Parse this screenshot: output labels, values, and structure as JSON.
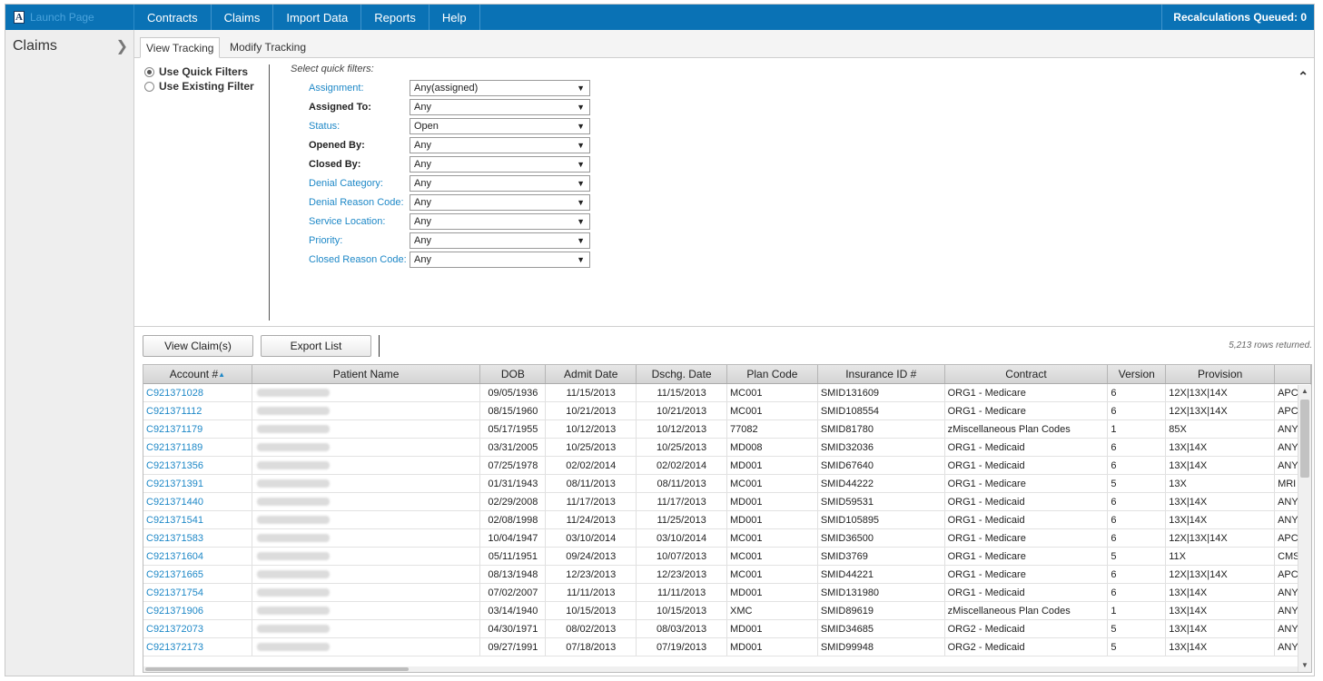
{
  "topbar": {
    "launch_label": "Launch Page",
    "logo_letter": "A",
    "nav": [
      "Contracts",
      "Claims",
      "Import Data",
      "Reports",
      "Help"
    ],
    "recalc": "Recalculations Queued: 0"
  },
  "sidebar": {
    "title": "Claims"
  },
  "tabs": [
    "View Tracking",
    "Modify Tracking"
  ],
  "filter_mode": {
    "quick": "Use Quick Filters",
    "existing": "Use Existing Filter",
    "selected": "quick"
  },
  "quick_filters": {
    "title": "Select quick filters:",
    "rows": [
      {
        "label": "Assignment:",
        "value": "Any(assigned)",
        "style": "link"
      },
      {
        "label": "Assigned To:",
        "value": "Any",
        "style": "bold"
      },
      {
        "label": "Status:",
        "value": "Open",
        "style": "link"
      },
      {
        "label": "Opened By:",
        "value": "Any",
        "style": "bold"
      },
      {
        "label": "Closed By:",
        "value": "Any",
        "style": "bold"
      },
      {
        "label": "Denial Category:",
        "value": "Any",
        "style": "link"
      },
      {
        "label": "Denial Reason Code:",
        "value": "Any",
        "style": "link"
      },
      {
        "label": "Service Location:",
        "value": "Any",
        "style": "link"
      },
      {
        "label": "Priority:",
        "value": "Any",
        "style": "link"
      },
      {
        "label": "Closed Reason Code:",
        "value": "Any",
        "style": "link"
      }
    ]
  },
  "actions": {
    "view": "View Claim(s)",
    "export": "Export List",
    "rows_returned": "5,213 rows returned."
  },
  "table": {
    "sort_column": "Account #",
    "sort_dir": "asc",
    "columns": [
      "Account #",
      "Patient Name",
      "DOB",
      "Admit Date",
      "Dschg. Date",
      "Plan Code",
      "Insurance ID #",
      "Contract",
      "Version",
      "Provision",
      ""
    ],
    "rows": [
      [
        "C921371028",
        "",
        "09/05/1936",
        "11/15/2013",
        "11/15/2013",
        "MC001",
        "SMID131609",
        "ORG1 - Medicare",
        "6",
        "12X|13X|14X",
        "APC"
      ],
      [
        "C921371112",
        "",
        "08/15/1960",
        "10/21/2013",
        "10/21/2013",
        "MC001",
        "SMID108554",
        "ORG1 - Medicare",
        "6",
        "12X|13X|14X",
        "APC"
      ],
      [
        "C921371179",
        "",
        "05/17/1955",
        "10/12/2013",
        "10/12/2013",
        "77082",
        "SMID81780",
        "zMiscellaneous Plan Codes",
        "1",
        "85X",
        "ANY"
      ],
      [
        "C921371189",
        "",
        "03/31/2005",
        "10/25/2013",
        "10/25/2013",
        "MD008",
        "SMID32036",
        "ORG1 - Medicaid",
        "6",
        "13X|14X",
        "ANY"
      ],
      [
        "C921371356",
        "",
        "07/25/1978",
        "02/02/2014",
        "02/02/2014",
        "MD001",
        "SMID67640",
        "ORG1 - Medicaid",
        "6",
        "13X|14X",
        "ANY"
      ],
      [
        "C921371391",
        "",
        "01/31/1943",
        "08/11/2013",
        "08/11/2013",
        "MC001",
        "SMID44222",
        "ORG1 - Medicare",
        "5",
        "13X",
        "MRI"
      ],
      [
        "C921371440",
        "",
        "02/29/2008",
        "11/17/2013",
        "11/17/2013",
        "MD001",
        "SMID59531",
        "ORG1 - Medicaid",
        "6",
        "13X|14X",
        "ANY"
      ],
      [
        "C921371541",
        "",
        "02/08/1998",
        "11/24/2013",
        "11/25/2013",
        "MD001",
        "SMID105895",
        "ORG1 - Medicaid",
        "6",
        "13X|14X",
        "ANY"
      ],
      [
        "C921371583",
        "",
        "10/04/1947",
        "03/10/2014",
        "03/10/2014",
        "MC001",
        "SMID36500",
        "ORG1 - Medicare",
        "6",
        "12X|13X|14X",
        "APC"
      ],
      [
        "C921371604",
        "",
        "05/11/1951",
        "09/24/2013",
        "10/07/2013",
        "MC001",
        "SMID3769",
        "ORG1 - Medicare",
        "5",
        "11X",
        "CMS"
      ],
      [
        "C921371665",
        "",
        "08/13/1948",
        "12/23/2013",
        "12/23/2013",
        "MC001",
        "SMID44221",
        "ORG1 - Medicare",
        "6",
        "12X|13X|14X",
        "APC"
      ],
      [
        "C921371754",
        "",
        "07/02/2007",
        "11/11/2013",
        "11/11/2013",
        "MD001",
        "SMID131980",
        "ORG1 - Medicaid",
        "6",
        "13X|14X",
        "ANY"
      ],
      [
        "C921371906",
        "",
        "03/14/1940",
        "10/15/2013",
        "10/15/2013",
        "XMC",
        "SMID89619",
        "zMiscellaneous Plan Codes",
        "1",
        "13X|14X",
        "ANY"
      ],
      [
        "C921372073",
        "",
        "04/30/1971",
        "08/02/2013",
        "08/03/2013",
        "MD001",
        "SMID34685",
        "ORG2 - Medicaid",
        "5",
        "13X|14X",
        "ANY"
      ],
      [
        "C921372173",
        "",
        "09/27/1991",
        "07/18/2013",
        "07/19/2013",
        "MD001",
        "SMID99948",
        "ORG2 - Medicaid",
        "5",
        "13X|14X",
        "ANY"
      ]
    ]
  }
}
